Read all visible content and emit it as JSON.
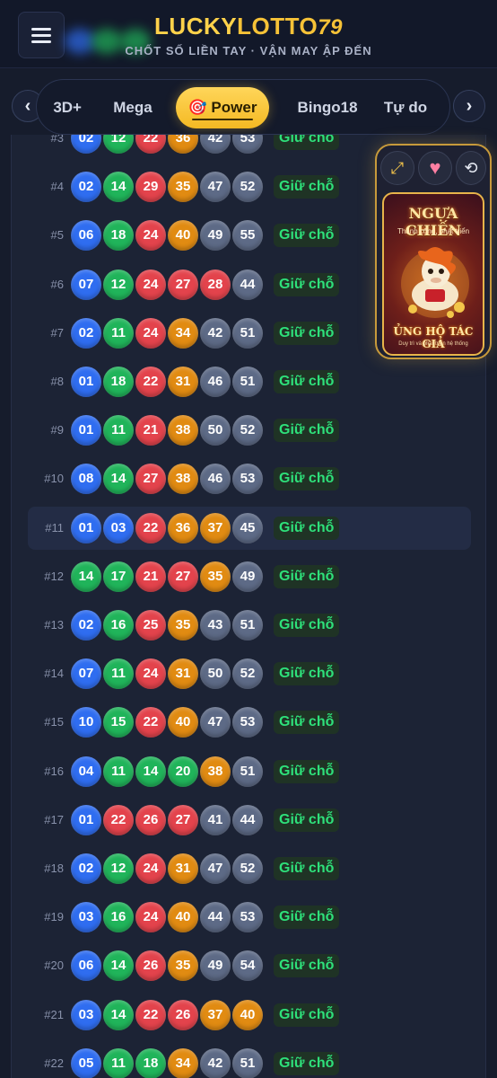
{
  "header": {
    "logo_part1": "LUCKY",
    "logo_part2": "LOTTO",
    "logo_symbol": "79",
    "tagline": "CHỐT SỐ LIỀN TAY · VẬN MAY ẬP ĐẾN"
  },
  "tabs": {
    "items": [
      {
        "label": "3D+"
      },
      {
        "label": "Mega"
      },
      {
        "label": "🎯 Power"
      },
      {
        "label": "Bingo18"
      },
      {
        "label": "Tự do"
      }
    ],
    "active": "🎯 Power",
    "prev_icon": "‹",
    "next_icon": "›"
  },
  "hold_label": "Giữ chỗ",
  "rows": [
    {
      "idx": "#3",
      "balls": [
        {
          "n": "02",
          "c": "blue"
        },
        {
          "n": "12",
          "c": "green"
        },
        {
          "n": "22",
          "c": "red"
        },
        {
          "n": "36",
          "c": "orange"
        },
        {
          "n": "42",
          "c": "gray"
        },
        {
          "n": "53",
          "c": "gray"
        }
      ]
    },
    {
      "idx": "#4",
      "balls": [
        {
          "n": "02",
          "c": "blue"
        },
        {
          "n": "14",
          "c": "green"
        },
        {
          "n": "29",
          "c": "red"
        },
        {
          "n": "35",
          "c": "orange"
        },
        {
          "n": "47",
          "c": "gray"
        },
        {
          "n": "52",
          "c": "gray"
        }
      ]
    },
    {
      "idx": "#5",
      "balls": [
        {
          "n": "06",
          "c": "blue"
        },
        {
          "n": "18",
          "c": "green"
        },
        {
          "n": "24",
          "c": "red"
        },
        {
          "n": "40",
          "c": "orange"
        },
        {
          "n": "49",
          "c": "gray"
        },
        {
          "n": "55",
          "c": "gray"
        }
      ]
    },
    {
      "idx": "#6",
      "balls": [
        {
          "n": "07",
          "c": "blue"
        },
        {
          "n": "12",
          "c": "green"
        },
        {
          "n": "24",
          "c": "red"
        },
        {
          "n": "27",
          "c": "red"
        },
        {
          "n": "28",
          "c": "red"
        },
        {
          "n": "44",
          "c": "gray"
        }
      ]
    },
    {
      "idx": "#7",
      "balls": [
        {
          "n": "02",
          "c": "blue"
        },
        {
          "n": "11",
          "c": "green"
        },
        {
          "n": "24",
          "c": "red"
        },
        {
          "n": "34",
          "c": "orange"
        },
        {
          "n": "42",
          "c": "gray"
        },
        {
          "n": "51",
          "c": "gray"
        }
      ]
    },
    {
      "idx": "#8",
      "balls": [
        {
          "n": "01",
          "c": "blue"
        },
        {
          "n": "18",
          "c": "green"
        },
        {
          "n": "22",
          "c": "red"
        },
        {
          "n": "31",
          "c": "orange"
        },
        {
          "n": "46",
          "c": "gray"
        },
        {
          "n": "51",
          "c": "gray"
        }
      ]
    },
    {
      "idx": "#9",
      "balls": [
        {
          "n": "01",
          "c": "blue"
        },
        {
          "n": "11",
          "c": "green"
        },
        {
          "n": "21",
          "c": "red"
        },
        {
          "n": "38",
          "c": "orange"
        },
        {
          "n": "50",
          "c": "gray"
        },
        {
          "n": "52",
          "c": "gray"
        }
      ]
    },
    {
      "idx": "#10",
      "balls": [
        {
          "n": "08",
          "c": "blue"
        },
        {
          "n": "14",
          "c": "green"
        },
        {
          "n": "27",
          "c": "red"
        },
        {
          "n": "38",
          "c": "orange"
        },
        {
          "n": "46",
          "c": "gray"
        },
        {
          "n": "53",
          "c": "gray"
        }
      ]
    },
    {
      "idx": "#11",
      "highlight": true,
      "balls": [
        {
          "n": "01",
          "c": "blue"
        },
        {
          "n": "03",
          "c": "blue"
        },
        {
          "n": "22",
          "c": "red"
        },
        {
          "n": "36",
          "c": "orange"
        },
        {
          "n": "37",
          "c": "orange"
        },
        {
          "n": "45",
          "c": "gray"
        }
      ]
    },
    {
      "idx": "#12",
      "balls": [
        {
          "n": "14",
          "c": "green"
        },
        {
          "n": "17",
          "c": "green"
        },
        {
          "n": "21",
          "c": "red"
        },
        {
          "n": "27",
          "c": "red"
        },
        {
          "n": "35",
          "c": "orange"
        },
        {
          "n": "49",
          "c": "gray"
        }
      ]
    },
    {
      "idx": "#13",
      "balls": [
        {
          "n": "02",
          "c": "blue"
        },
        {
          "n": "16",
          "c": "green"
        },
        {
          "n": "25",
          "c": "red"
        },
        {
          "n": "35",
          "c": "orange"
        },
        {
          "n": "43",
          "c": "gray"
        },
        {
          "n": "51",
          "c": "gray"
        }
      ]
    },
    {
      "idx": "#14",
      "balls": [
        {
          "n": "07",
          "c": "blue"
        },
        {
          "n": "11",
          "c": "green"
        },
        {
          "n": "24",
          "c": "red"
        },
        {
          "n": "31",
          "c": "orange"
        },
        {
          "n": "50",
          "c": "gray"
        },
        {
          "n": "52",
          "c": "gray"
        }
      ]
    },
    {
      "idx": "#15",
      "balls": [
        {
          "n": "10",
          "c": "blue"
        },
        {
          "n": "15",
          "c": "green"
        },
        {
          "n": "22",
          "c": "red"
        },
        {
          "n": "40",
          "c": "orange"
        },
        {
          "n": "47",
          "c": "gray"
        },
        {
          "n": "53",
          "c": "gray"
        }
      ]
    },
    {
      "idx": "#16",
      "balls": [
        {
          "n": "04",
          "c": "blue"
        },
        {
          "n": "11",
          "c": "green"
        },
        {
          "n": "14",
          "c": "green"
        },
        {
          "n": "20",
          "c": "green"
        },
        {
          "n": "38",
          "c": "orange"
        },
        {
          "n": "51",
          "c": "gray"
        }
      ]
    },
    {
      "idx": "#17",
      "balls": [
        {
          "n": "01",
          "c": "blue"
        },
        {
          "n": "22",
          "c": "red"
        },
        {
          "n": "26",
          "c": "red"
        },
        {
          "n": "27",
          "c": "red"
        },
        {
          "n": "41",
          "c": "gray"
        },
        {
          "n": "44",
          "c": "gray"
        }
      ]
    },
    {
      "idx": "#18",
      "balls": [
        {
          "n": "02",
          "c": "blue"
        },
        {
          "n": "12",
          "c": "green"
        },
        {
          "n": "24",
          "c": "red"
        },
        {
          "n": "31",
          "c": "orange"
        },
        {
          "n": "47",
          "c": "gray"
        },
        {
          "n": "52",
          "c": "gray"
        }
      ]
    },
    {
      "idx": "#19",
      "balls": [
        {
          "n": "03",
          "c": "blue"
        },
        {
          "n": "16",
          "c": "green"
        },
        {
          "n": "24",
          "c": "red"
        },
        {
          "n": "40",
          "c": "orange"
        },
        {
          "n": "44",
          "c": "gray"
        },
        {
          "n": "53",
          "c": "gray"
        }
      ]
    },
    {
      "idx": "#20",
      "balls": [
        {
          "n": "06",
          "c": "blue"
        },
        {
          "n": "14",
          "c": "green"
        },
        {
          "n": "26",
          "c": "red"
        },
        {
          "n": "35",
          "c": "orange"
        },
        {
          "n": "49",
          "c": "gray"
        },
        {
          "n": "54",
          "c": "gray"
        }
      ]
    },
    {
      "idx": "#21",
      "balls": [
        {
          "n": "03",
          "c": "blue"
        },
        {
          "n": "14",
          "c": "green"
        },
        {
          "n": "22",
          "c": "red"
        },
        {
          "n": "26",
          "c": "red"
        },
        {
          "n": "37",
          "c": "orange"
        },
        {
          "n": "40",
          "c": "orange"
        }
      ]
    },
    {
      "idx": "#22",
      "balls": [
        {
          "n": "05",
          "c": "blue"
        },
        {
          "n": "11",
          "c": "green"
        },
        {
          "n": "18",
          "c": "green"
        },
        {
          "n": "34",
          "c": "orange"
        },
        {
          "n": "42",
          "c": "gray"
        },
        {
          "n": "51",
          "c": "gray"
        }
      ]
    }
  ],
  "ad": {
    "title": "NGỰA CHIẾN",
    "subtitle": "Thành công, phát triển",
    "cta": "ỦNG HỘ TÁC GIẢ",
    "note": "Duy trì và phát triển hệ thống",
    "controls": [
      {
        "name": "expand-icon",
        "glyph": "⤢"
      },
      {
        "name": "heart-icon",
        "glyph": "♥"
      },
      {
        "name": "refresh-icon",
        "glyph": "⟲"
      }
    ]
  },
  "colors": {
    "blue": "#2f6df0",
    "green": "#20b45a",
    "red": "#e3434c",
    "orange": "#e18b12",
    "gray": "#5d6a86",
    "accent": "#f6c237",
    "hold_text": "#2ee07a"
  }
}
